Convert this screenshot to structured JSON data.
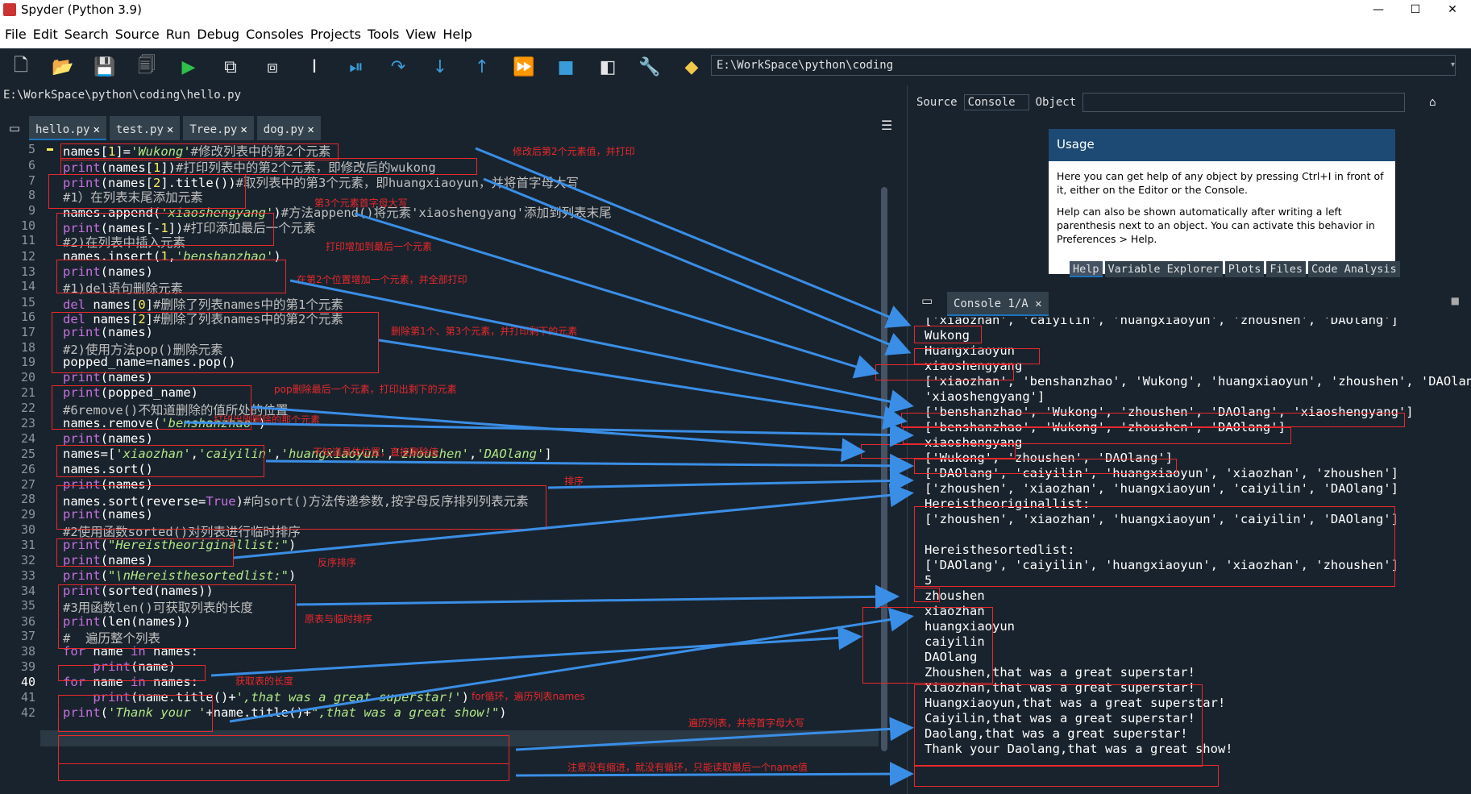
{
  "window": {
    "title": "Spyder (Python 3.9)",
    "minimize": "—",
    "maximize": "☐",
    "close": "✕"
  },
  "menu": [
    "File",
    "Edit",
    "Search",
    "Source",
    "Run",
    "Debug",
    "Consoles",
    "Projects",
    "Tools",
    "View",
    "Help"
  ],
  "toolbar": {
    "icons": [
      "new-file-icon",
      "open-file-icon",
      "save-icon",
      "save-all-icon",
      "run-icon",
      "run-cell-icon",
      "run-cell-advance-icon",
      "run-selection-icon",
      "debug-icon",
      "step-icon",
      "step-into-icon",
      "step-return-icon",
      "continue-icon",
      "stop-icon",
      "maximize-pane-icon",
      "wrench-icon",
      "python-path-icon"
    ],
    "working_dir": "E:\\WorkSpace\\python\\coding"
  },
  "editor": {
    "file_path": "E:\\WorkSpace\\python\\coding\\hello.py",
    "tabs": [
      {
        "label": "hello.py",
        "active": true
      },
      {
        "label": "test.py",
        "active": false
      },
      {
        "label": "Tree.py",
        "active": false
      },
      {
        "label": "dog.py",
        "active": false
      }
    ],
    "current_line": "40"
  },
  "help_pane": {
    "source_label": "Source",
    "source_combo": "Console",
    "object_label": "Object",
    "usage_title": "Usage",
    "usage_p1": "Here you can get help of any object by pressing Ctrl+I in front of it, either on the Editor or the Console.",
    "usage_p2": "Help can also be shown automatically after writing a left parenthesis next to an object. You can activate this behavior in Preferences > Help.",
    "tabs": [
      "Help",
      "Variable Explorer",
      "Plots",
      "Files",
      "Code Analysis"
    ]
  },
  "console": {
    "tab_label": "Console 1/A",
    "lines": [
      "['xiaozhan', 'caiyilin', 'huangxiaoyun', 'zhoushen', 'DAOlang']",
      "Wukong",
      "Huangxiaoyun",
      "xiaoshengyang",
      "['xiaozhan', 'benshanzhao', 'Wukong', 'huangxiaoyun', 'zhoushen', 'DAOlang',",
      "'xiaoshengyang']",
      "['benshanzhao', 'Wukong', 'zhoushen', 'DAOlang', 'xiaoshengyang']",
      "['benshanzhao', 'Wukong', 'zhoushen', 'DAOlang']",
      "xiaoshengyang",
      "['Wukong', 'zhoushen', 'DAOlang']",
      "['DAOlang', 'caiyilin', 'huangxiaoyun', 'xiaozhan', 'zhoushen']",
      "['zhoushen', 'xiaozhan', 'huangxiaoyun', 'caiyilin', 'DAOlang']",
      "Hereistheoriginallist:",
      "['zhoushen', 'xiaozhan', 'huangxiaoyun', 'caiyilin', 'DAOlang']",
      "",
      "Hereisthesortedlist:",
      "['DAOlang', 'caiyilin', 'huangxiaoyun', 'xiaozhan', 'zhoushen']",
      "5",
      "zhoushen",
      "xiaozhan",
      "huangxiaoyun",
      "caiyilin",
      "DAOlang",
      "Zhoushen,that was a great superstar!",
      "Xiaozhan,that was a great superstar!",
      "Huangxiaoyun,that was a great superstar!",
      "Caiyilin,that was a great superstar!",
      "Daolang,that was a great superstar!",
      "Thank your Daolang,that was a great show!"
    ]
  },
  "annotations": [
    "修改后第2个元素值，并打印",
    "第3个元素首字母大写",
    "打印增加到最后一个元素",
    "在第2个位置增加一个元素，并全部打印",
    "删除第1个、第3个元素，并打印剩下的元素",
    "pop删除最后一个元素，打印出剩下的元素",
    "打印出刚删除的那个元素",
    "不知道具体位置，直接删除值",
    "排序",
    "反序排序",
    "原表与临时排序",
    "获取表的长度",
    "for循环，遍历列表names",
    "遍历列表，并将首字母大写",
    "注意没有缩进，就没有循环，只能读取最后一个name值"
  ]
}
